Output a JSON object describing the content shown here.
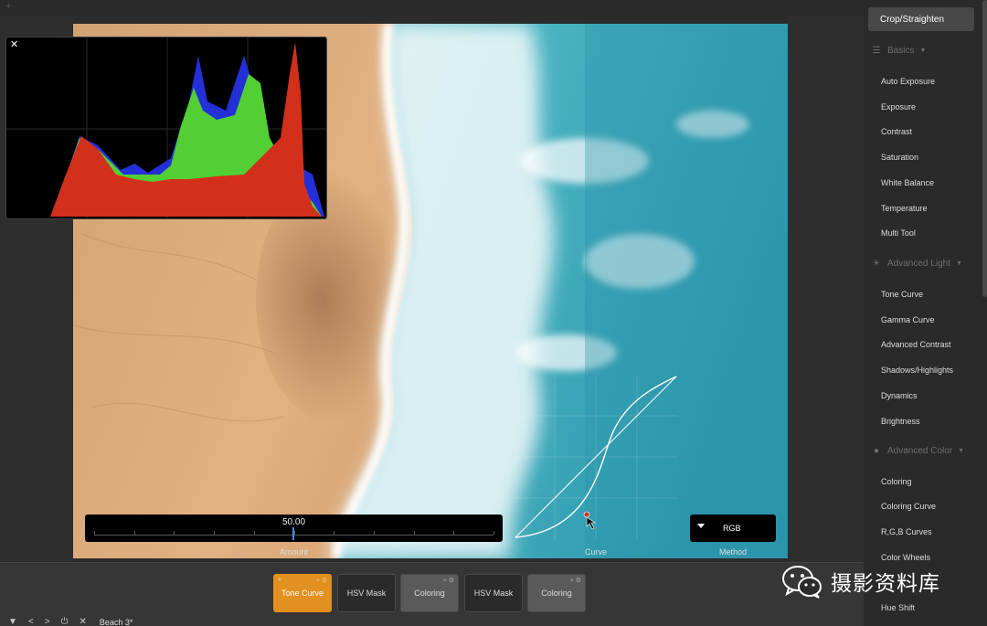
{
  "app": {
    "file_name": "Beach 3*"
  },
  "histogram": {
    "close_label": "✕"
  },
  "controls": {
    "amount_value": "50.00",
    "amount_label": "Amount",
    "curve_label": "Curve",
    "method_label": "Method",
    "method_value": "RGB"
  },
  "nodes": [
    {
      "label": "Tone Curve",
      "active": true
    },
    {
      "label": "HSV Mask"
    },
    {
      "label": "Coloring"
    },
    {
      "label": "HSV Mask"
    },
    {
      "label": "Coloring"
    }
  ],
  "toolbar": {
    "collapse": "▼",
    "prev": "<",
    "next": ">",
    "power": "⏻",
    "close": "✕"
  },
  "sidebar": {
    "crop": "Crop/Straighten",
    "basics": {
      "title": "Basics",
      "items": [
        "Auto Exposure",
        "Exposure",
        "Contrast",
        "Saturation",
        "White Balance",
        "Temperature",
        "Multi Tool"
      ]
    },
    "advanced_light": {
      "title": "Advanced Light",
      "items": [
        "Tone Curve",
        "Gamma Curve",
        "Advanced Contrast",
        "Shadows/Highlights",
        "Dynamics",
        "Brightness"
      ]
    },
    "advanced_color": {
      "title": "Advanced Color",
      "items": [
        "Coloring",
        "Coloring Curve",
        "R,G,B Curves",
        "Color Wheels",
        "Hue Shift"
      ]
    }
  },
  "watermark": {
    "text": "摄影资料库"
  },
  "colors": {
    "accent": "#e2901f",
    "hist_red": "#d2301a",
    "hist_green": "#52cf35",
    "hist_blue": "#2330d8",
    "sand": "#d9a878",
    "sea": "#3fa8b8"
  }
}
